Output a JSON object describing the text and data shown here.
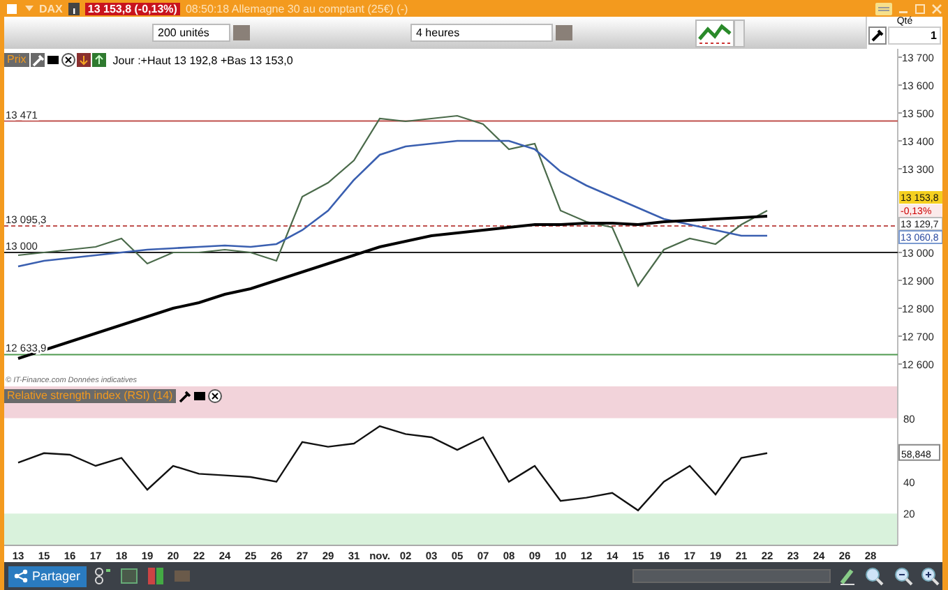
{
  "window": {
    "symbol": "DAX",
    "quote": "13 153,8 (-0,13%)",
    "title": "08:50:18 Allemagne 30 au comptant (25€) (-)"
  },
  "toolbar": {
    "quantity_field": {
      "value": "200 unités"
    },
    "period_dropdown": {
      "value": "4 heures"
    }
  },
  "order_panel": {
    "label": "Qté",
    "quantity": "1"
  },
  "price_chart": {
    "badge": "Prix",
    "legend": "Jour :+Haut 13 192,8 +Bas 13 153,0",
    "credit": "© IT-Finance.com Données indicatives",
    "price_tags": [
      {
        "kind": "last",
        "label": "13 153,8"
      },
      {
        "kind": "change",
        "label": "-0,13%"
      },
      {
        "kind": "plain",
        "label": "13 129,7"
      },
      {
        "kind": "average",
        "label": "13 060,8"
      }
    ],
    "chart_data": {
      "type": "line",
      "ylim": [
        12520,
        13730
      ],
      "yticks": [
        {
          "value": 13700,
          "label": "13 700"
        },
        {
          "value": 13600,
          "label": "13 600"
        },
        {
          "value": 13500,
          "label": "13 500"
        },
        {
          "value": 13400,
          "label": "13 400"
        },
        {
          "value": 13300,
          "label": "13 300"
        },
        {
          "value": 13000,
          "label": "13 000"
        },
        {
          "value": 12900,
          "label": "12 900"
        },
        {
          "value": 12800,
          "label": "12 800"
        },
        {
          "value": 12700,
          "label": "12 700"
        },
        {
          "value": 12600,
          "label": "12 600"
        }
      ],
      "ref_lines": [
        {
          "axis": "y",
          "value": 13471,
          "label": "13 471",
          "color": "#c0504d"
        },
        {
          "axis": "y",
          "value": 13095.3,
          "label": "13 095,3",
          "color": "#c0504d"
        },
        {
          "axis": "y",
          "value": 13000,
          "label": "13 000",
          "color": "#222222"
        },
        {
          "axis": "y",
          "value": 12633.9,
          "label": "12 633,9",
          "color": "#4f9a4f"
        }
      ],
      "series": [
        {
          "color": "#4a6a4a",
          "values": [
            12990,
            13000,
            13010,
            13020,
            13050,
            12960,
            13000,
            13000,
            13010,
            13000,
            12970,
            13200,
            13250,
            13330,
            13480,
            13470,
            13480,
            13490,
            13460,
            13370,
            13390,
            13150,
            13110,
            13090,
            12880,
            13010,
            13050,
            13030,
            13100,
            13150,
            null,
            null,
            null,
            null
          ]
        },
        {
          "color": "#3a5fb0",
          "values": [
            12950,
            12970,
            12980,
            12990,
            13000,
            13010,
            13015,
            13020,
            13025,
            13020,
            13030,
            13080,
            13150,
            13260,
            13350,
            13380,
            13390,
            13400,
            13400,
            13400,
            13370,
            13290,
            13240,
            13200,
            13160,
            13120,
            13100,
            13080,
            13060,
            13060,
            null,
            null,
            null,
            null
          ]
        },
        {
          "color": "#000000",
          "values": [
            12620,
            12650,
            12680,
            12710,
            12740,
            12770,
            12800,
            12820,
            12850,
            12870,
            12900,
            12930,
            12960,
            12990,
            13020,
            13040,
            13060,
            13070,
            13080,
            13090,
            13100,
            13100,
            13105,
            13105,
            13100,
            13110,
            13115,
            13120,
            13125,
            13130,
            null,
            null,
            null,
            null
          ]
        }
      ]
    }
  },
  "rsi_chart": {
    "title": "Relative strength index (RSI) (14)",
    "reading": "58,848",
    "chart_data": {
      "type": "line",
      "categories": [
        "13",
        "15",
        "16",
        "17",
        "18",
        "19",
        "20",
        "22",
        "24",
        "25",
        "26",
        "27",
        "29",
        "31",
        "nov.",
        "02",
        "03",
        "05",
        "07",
        "08",
        "09",
        "10",
        "12",
        "14",
        "15",
        "16",
        "17",
        "19",
        "21",
        "22",
        "23",
        "24",
        "26",
        "28"
      ],
      "ylim": [
        0,
        100
      ],
      "yticks": [
        20,
        40,
        80
      ],
      "bands": [
        {
          "axis": "y",
          "from": 80,
          "to": 100,
          "color": "#f2d3da"
        },
        {
          "axis": "y",
          "from": 0,
          "to": 20,
          "color": "#d9f2dc"
        }
      ],
      "series": [
        {
          "color": "#111111",
          "values": [
            52,
            58,
            57,
            50,
            55,
            35,
            50,
            45,
            44,
            43,
            40,
            65,
            62,
            64,
            75,
            70,
            68,
            60,
            68,
            40,
            50,
            28,
            30,
            33,
            22,
            40,
            50,
            32,
            55,
            58,
            null,
            null,
            null,
            null
          ]
        }
      ]
    }
  },
  "bottom_bar": {
    "share_button": "Partager"
  }
}
